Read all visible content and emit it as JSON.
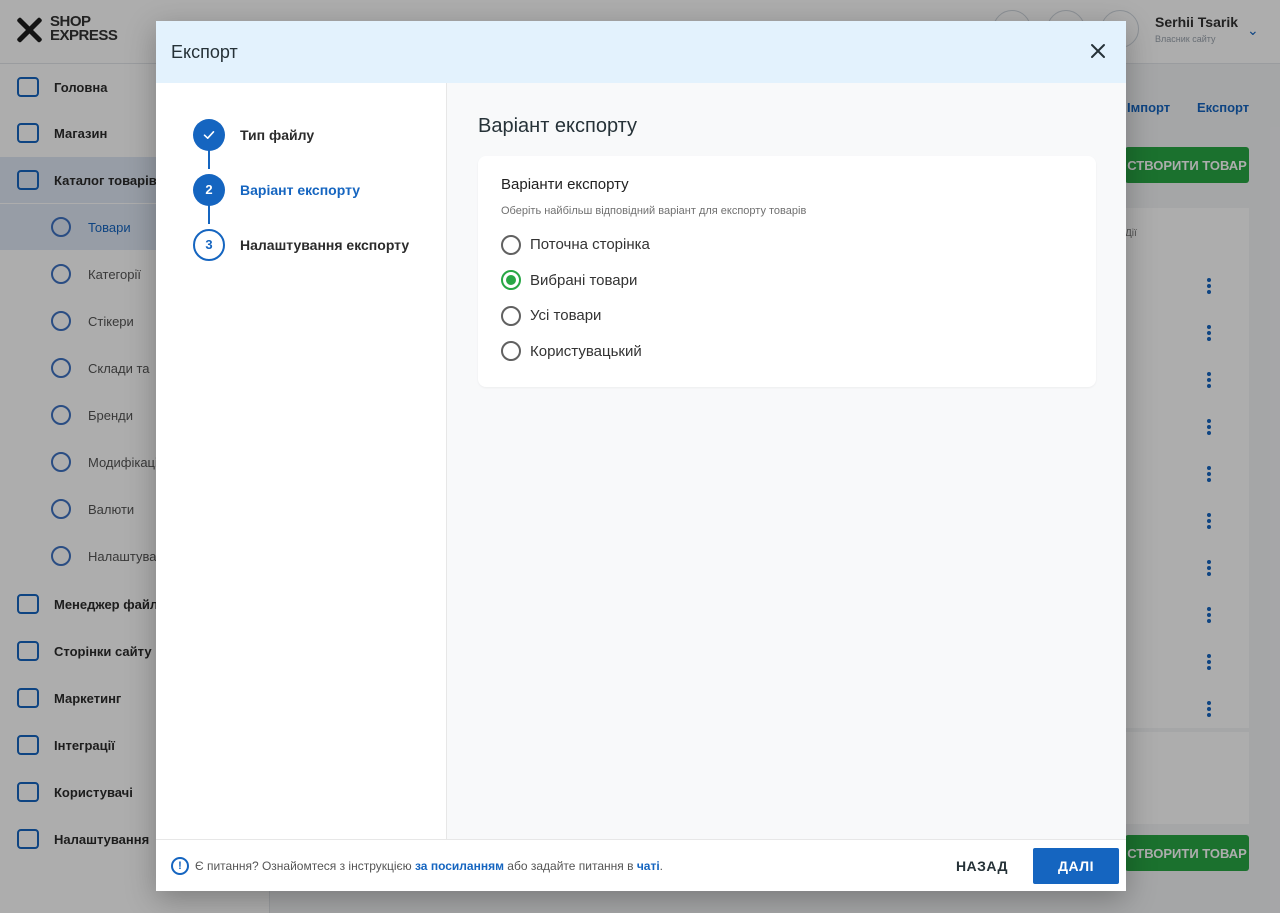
{
  "background": {
    "logo": {
      "line1": "SHOP",
      "line2": "EXPRESS"
    },
    "user": {
      "name": "Serhii Tsarik",
      "sub": "Власник сайту"
    },
    "sidebar": {
      "items": [
        {
          "label": "Головна",
          "icon": "home-icon"
        },
        {
          "label": "Магазин",
          "icon": "cart-icon"
        },
        {
          "label": "Каталог товарів",
          "icon": "book-icon"
        }
      ],
      "subitems": [
        {
          "label": "Товари",
          "icon": "box-icon"
        },
        {
          "label": "Категорії",
          "icon": "categories-icon"
        },
        {
          "label": "Стікери",
          "icon": "sticker-icon"
        },
        {
          "label": "Склади та",
          "icon": "warehouse-icon"
        },
        {
          "label": "Бренди",
          "icon": "tag-icon"
        },
        {
          "label": "Модифікації",
          "icon": "bookmark-icon"
        },
        {
          "label": "Валюти",
          "icon": "currency-icon"
        },
        {
          "label": "Налаштування",
          "icon": "gear-icon"
        }
      ],
      "bottom_items": [
        {
          "label": "Менеджер файлів",
          "icon": "folder-icon"
        },
        {
          "label": "Сторінки сайту",
          "icon": "pages-icon"
        },
        {
          "label": "Маркетинг",
          "icon": "marketing-icon"
        },
        {
          "label": "Інтеграції",
          "icon": "megaphone-icon"
        },
        {
          "label": "Користувачі",
          "icon": "users-icon"
        },
        {
          "label": "Налаштування",
          "icon": "settings-icon"
        }
      ]
    },
    "import_link": "Імпорт",
    "export_link": "Експорт",
    "create_button": "СТВОРИТИ ТОВАР",
    "column_label": "Дії"
  },
  "modal": {
    "title": "Експорт",
    "steps": [
      {
        "number": "1",
        "label": "Тип файлу",
        "state": "done"
      },
      {
        "number": "2",
        "label": "Варіант експорту",
        "state": "active"
      },
      {
        "number": "3",
        "label": "Налаштування експорту",
        "state": "pending"
      }
    ],
    "content_title": "Варіант експорту",
    "card": {
      "title": "Варіанти експорту",
      "subtitle": "Оберіть найбільш відповідний варіант для експорту товарів",
      "options": [
        {
          "label": "Поточна сторінка",
          "checked": false
        },
        {
          "label": "Вибрані товари",
          "checked": true
        },
        {
          "label": "Усі товари",
          "checked": false
        },
        {
          "label": "Користувацький",
          "checked": false
        }
      ]
    },
    "footer": {
      "text_before": "Є питання? Ознайомтеся з інструкцією ",
      "link1": "за посиланням",
      "text_middle": " або задайте питання в ",
      "link2": "чаті",
      "text_after": ".",
      "back_label": "НАЗАД",
      "next_label": "ДАЛІ"
    }
  },
  "colors": {
    "primary": "#1565c0",
    "success": "#28a745",
    "header_bg": "#e3f2fd"
  }
}
